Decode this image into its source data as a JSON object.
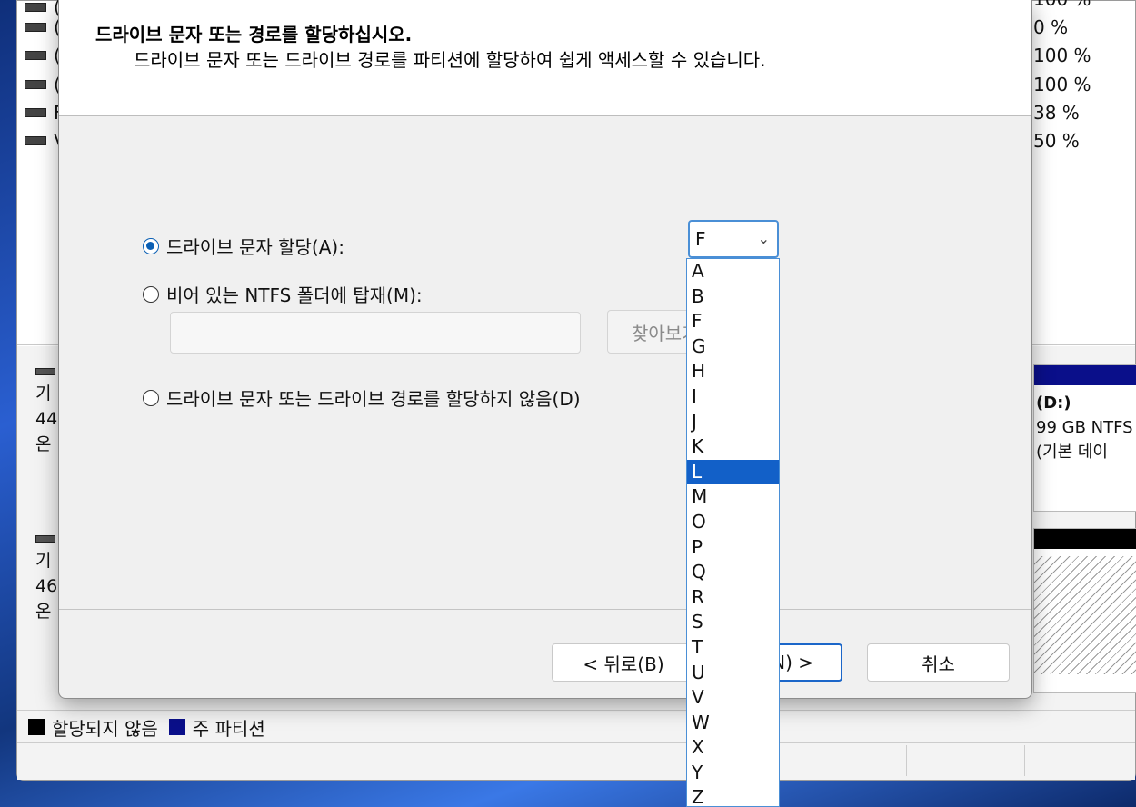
{
  "background_window": {
    "volume_rows": [
      "(",
      "(",
      "(",
      "F",
      "V"
    ],
    "percents": [
      "100 %",
      "0 %",
      "100 %",
      "100 %",
      "38 %",
      "50 %"
    ],
    "disk1": {
      "l1": "기",
      "l2": "44",
      "l3": "온"
    },
    "disk2": {
      "l1": "기",
      "l2": "46",
      "l3": "온"
    },
    "partition_d": {
      "name": "(D:)",
      "size": "99 GB NTFS",
      "type": "(기본 데이"
    },
    "legend": {
      "unallocated": "할당되지 않음",
      "primary": "주 파티션",
      "unallocated_color": "#000000",
      "primary_color": "#0a0f8a"
    }
  },
  "dialog": {
    "title": "드라이브 문자 또는 경로를 할당하십시오.",
    "subtitle": "드라이브 문자 또는 드라이브 경로를 파티션에 할당하여 쉽게 액세스할 수 있습니다.",
    "opt_assign": "드라이브 문자 할당(A):",
    "opt_mount": "비어 있는 NTFS 폴더에 탑재(M):",
    "opt_none": "드라이브 문자 또는 드라이브 경로를 할당하지 않음(D)",
    "browse": "찾아보기",
    "selected_letter": "F",
    "back": "< 뒤로(B)",
    "next": "N) >",
    "cancel": "취소"
  },
  "dropdown": {
    "items": [
      "A",
      "B",
      "F",
      "G",
      "H",
      "I",
      "J",
      "K",
      "L",
      "M",
      "O",
      "P",
      "Q",
      "R",
      "S",
      "T",
      "U",
      "V",
      "W",
      "X",
      "Y",
      "Z"
    ],
    "highlighted": "L"
  }
}
